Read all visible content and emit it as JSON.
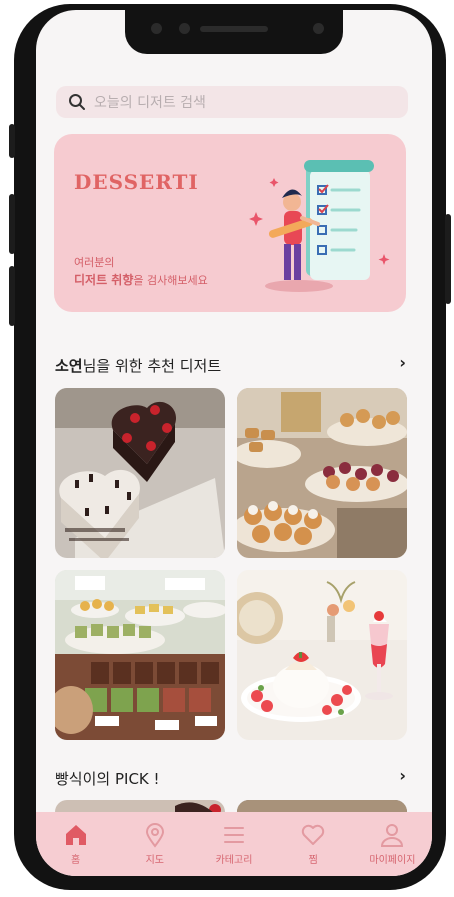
{
  "search": {
    "placeholder": "오늘의 디저트 검색"
  },
  "banner": {
    "brand": "DESSERTI",
    "line1": "여러분의",
    "line2_bold": "디저트 취향",
    "line2_rest": "을 검사해보세요"
  },
  "recommend": {
    "title_name": "소연",
    "title_rest": "님을 위한 추천 디저트",
    "chevron": "›"
  },
  "pick": {
    "title": "빵식이의 PICK !",
    "chevron": "›"
  },
  "nav": {
    "home": "홈",
    "map": "지도",
    "category": "카테고리",
    "wish": "찜",
    "mypage": "마이페이지"
  },
  "colors": {
    "accent": "#e06464",
    "banner": "#f6cbd0",
    "nav": "#f6cdd2",
    "home_active": "#e05a64",
    "nav_inactive": "#e39aa1"
  }
}
